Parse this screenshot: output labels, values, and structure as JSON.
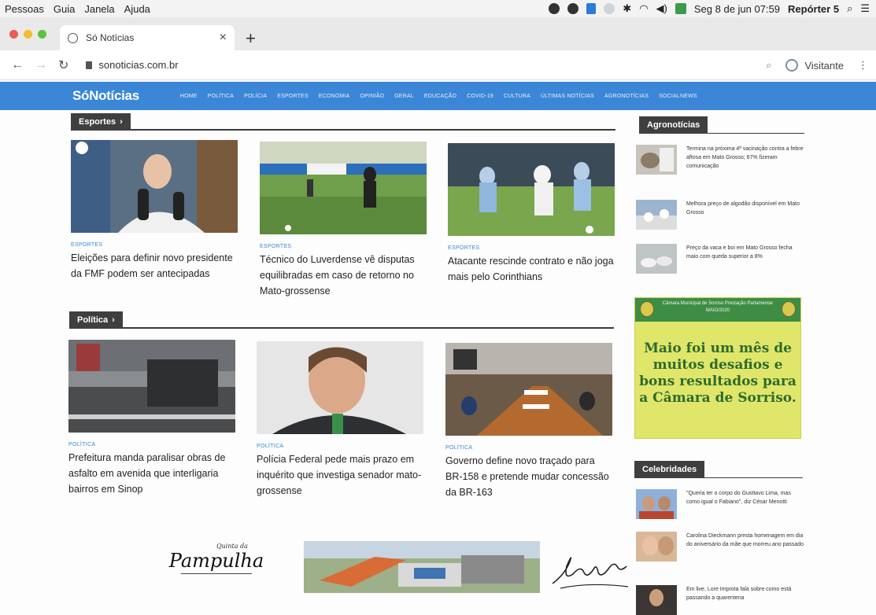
{
  "menubar": {
    "items": [
      "Pessoas",
      "Guia",
      "Janela",
      "Ajuda"
    ],
    "clock": "Seg 8 de jun 07:59",
    "user": "Repórter 5"
  },
  "browser": {
    "tab_title": "Só Notícias",
    "url": "sonoticias.com.br",
    "profile_label": "Visitante"
  },
  "site": {
    "logo": "SóNotícias",
    "nav": [
      "HOME",
      "POLÍTICA",
      "POLÍCIA",
      "ESPORTES",
      "ECONOMIA",
      "OPINIÃO",
      "GERAL",
      "EDUCAÇÃO",
      "COVID-19",
      "CULTURA",
      "ÚLTIMAS NOTÍCIAS",
      "AGRONOTÍCIAS",
      "SOCIALNEWS"
    ]
  },
  "sections": {
    "esportes": {
      "label": "Esportes",
      "articles": [
        {
          "category": "ESPORTES",
          "title": "Eleições para definir novo presidente da FMF podem ser antecipadas"
        },
        {
          "category": "ESPORTES",
          "title": "Técnico do Luverdense vê disputas equilibradas em caso de retorno no Mato-grossense"
        },
        {
          "category": "ESPORTES",
          "title": "Atacante rescinde contrato e não joga mais pelo Corinthians"
        }
      ]
    },
    "politica": {
      "label": "Política",
      "articles": [
        {
          "category": "POLÍTICA",
          "title": "Prefeitura manda paralisar obras de asfalto em avenida que interligaria bairros em Sinop"
        },
        {
          "category": "POLÍTICA",
          "title": "Polícia Federal pede mais prazo em inquérito que investiga senador mato-grossense"
        },
        {
          "category": "POLÍTICA",
          "title": "Governo define novo traçado para BR-158 e pretende mudar concessão da BR-163"
        }
      ]
    }
  },
  "sidebar": {
    "agro_label": "Agronotícias",
    "agro": [
      {
        "title": "Termina na próxima 4ª vacinação contra a febre aftosa em Mato Grosso; 67% fizeram comunicação"
      },
      {
        "title": "Melhora preço de algodão disponível em Mato Grosso"
      },
      {
        "title": "Preço da vaca e boi em Mato Grosso fecha maio com queda superior a 8%"
      }
    ],
    "ad": {
      "header": "Câmara Municipal de Sorriso Prestação Parlamentar MAIO/2020",
      "body": "Maio foi um mês de muitos desafios e bons resultados para a Câmara de Sorriso."
    },
    "celeb_label": "Celebridades",
    "celebs": [
      {
        "title": "\"Queria ter o corpo do Gusttavo Lima, mas como igual o Fabiano\", diz César Menotti"
      },
      {
        "title": "Carolina Dieckmann presta homenagem em dia do aniversário da mãe que morreu ano passado"
      },
      {
        "title": "Em live, Lore Improta fala sobre como está passando a quarentena"
      }
    ]
  },
  "bottom_ads": {
    "pampulha_small": "Quinta da",
    "pampulha_big": "Pampulha"
  },
  "colors": {
    "nav_blue": "#3b86d6",
    "ad_green": "#3d8e44",
    "ad_yellow": "#e0e66a"
  }
}
